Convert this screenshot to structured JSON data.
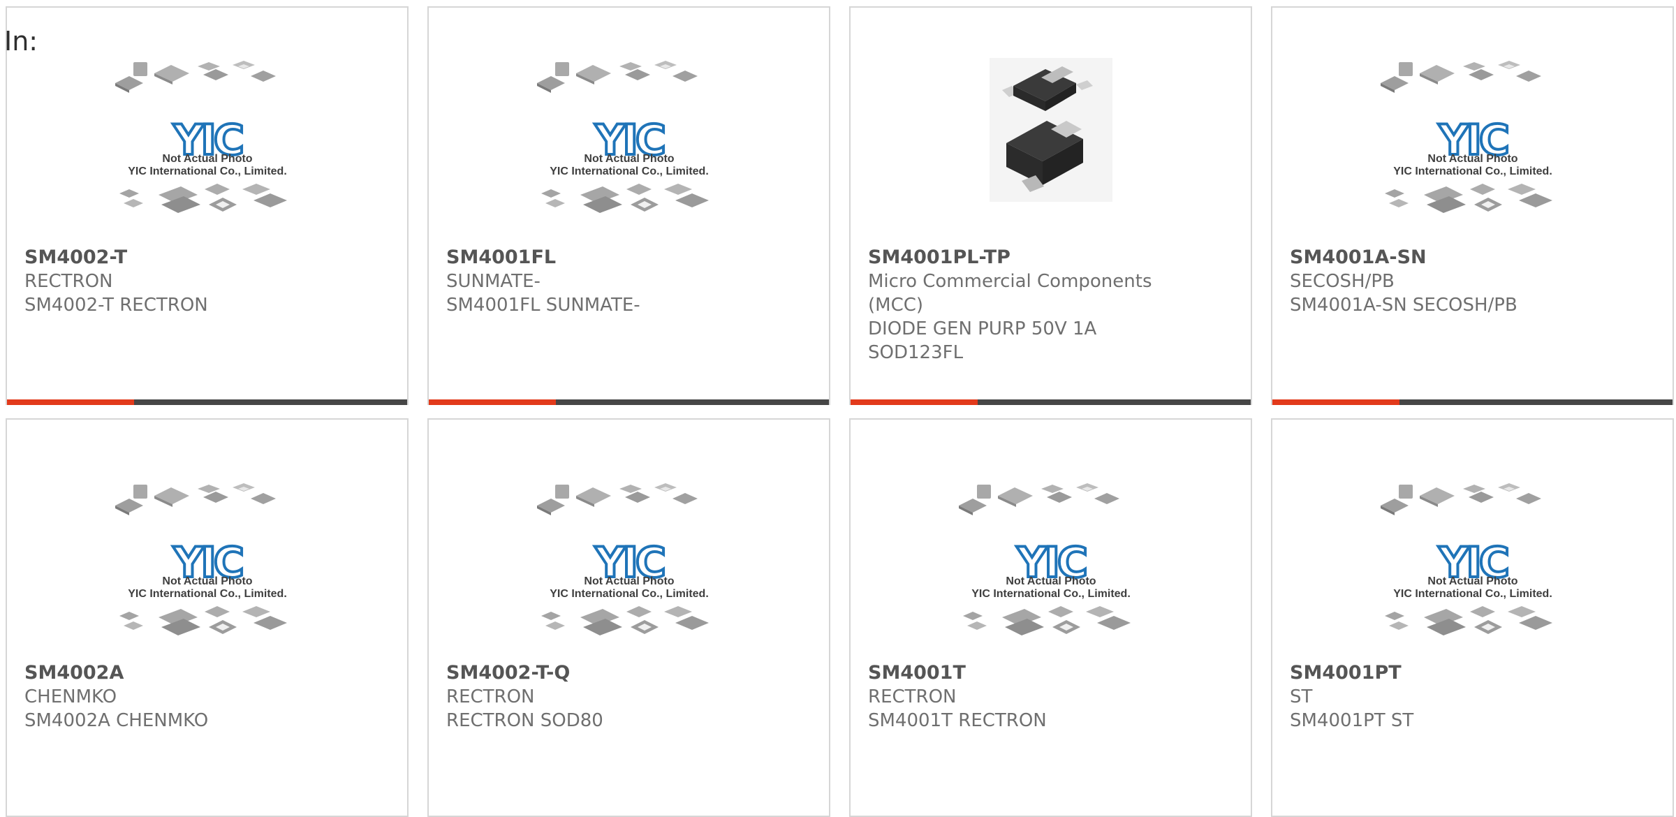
{
  "header": {
    "in_label": "In:"
  },
  "placeholder": {
    "logo_text": "YIC",
    "line1": "Not Actual Photo",
    "line2": "YIC International Co., Limited."
  },
  "colors": {
    "accent": "#e23a1b",
    "bar": "#464646",
    "logo_blue": "#1f74b8",
    "border": "#d6d6d6"
  },
  "products": [
    {
      "part": "SM4002-T",
      "lines": [
        "RECTRON",
        "SM4002-T RECTRON"
      ],
      "image": "placeholder",
      "has_bar": true
    },
    {
      "part": "SM4001FL",
      "lines": [
        "SUNMATE-",
        "SM4001FL SUNMATE-"
      ],
      "image": "placeholder",
      "has_bar": true
    },
    {
      "part": "SM4001PL-TP",
      "lines": [
        "Micro Commercial Components",
        "(MCC)",
        "DIODE GEN PURP 50V 1A",
        "SOD123FL"
      ],
      "image": "diode-photo",
      "has_bar": true
    },
    {
      "part": "SM4001A-SN",
      "lines": [
        "SECOSH/PB",
        "SM4001A-SN SECOSH/PB"
      ],
      "image": "placeholder",
      "has_bar": true
    },
    {
      "part": "SM4002A",
      "lines": [
        "CHENMKO",
        "SM4002A CHENMKO"
      ],
      "image": "placeholder",
      "has_bar": false
    },
    {
      "part": "SM4002-T-Q",
      "lines": [
        "RECTRON",
        "RECTRON SOD80"
      ],
      "image": "placeholder",
      "has_bar": false
    },
    {
      "part": "SM4001T",
      "lines": [
        "RECTRON",
        "SM4001T RECTRON"
      ],
      "image": "placeholder",
      "has_bar": false
    },
    {
      "part": "SM4001PT",
      "lines": [
        "ST",
        "SM4001PT ST"
      ],
      "image": "placeholder",
      "has_bar": false
    }
  ]
}
